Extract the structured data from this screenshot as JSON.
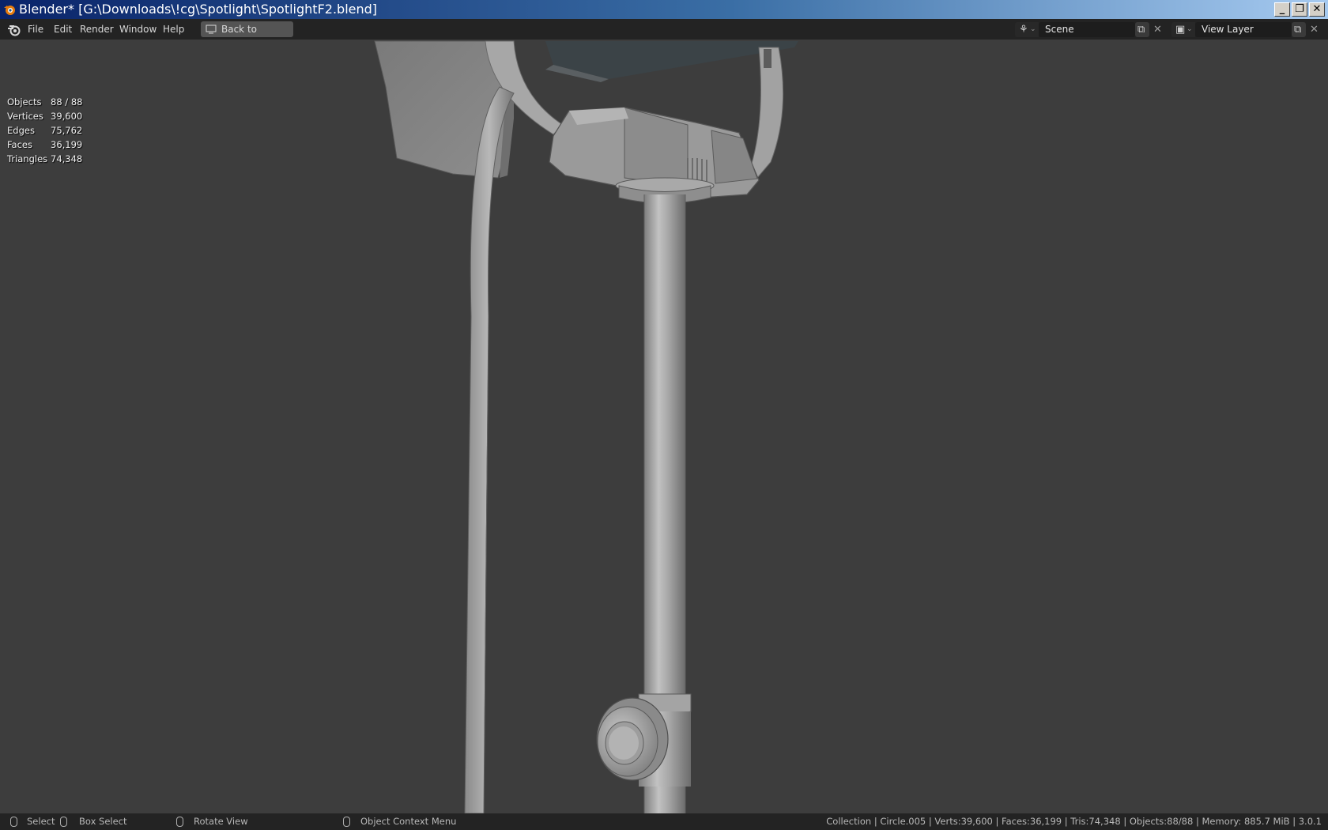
{
  "window": {
    "title": "Blender* [G:\\Downloads\\!cg\\Spotlight\\SpotlightF2.blend]",
    "minimize_glyph": "_",
    "restore_glyph": "❐",
    "close_glyph": "✕"
  },
  "menu": {
    "items": [
      "File",
      "Edit",
      "Render",
      "Window",
      "Help"
    ],
    "back_button": "Back to Previous"
  },
  "scene": {
    "label": "Scene"
  },
  "view_layer": {
    "label": "View Layer"
  },
  "stats": [
    {
      "key": "Objects",
      "value": "88 / 88"
    },
    {
      "key": "Vertices",
      "value": "39,600"
    },
    {
      "key": "Edges",
      "value": "75,762"
    },
    {
      "key": "Faces",
      "value": "36,199"
    },
    {
      "key": "Triangles",
      "value": "74,348"
    }
  ],
  "statusbar": {
    "select": "Select",
    "box_select": "Box Select",
    "rotate_view": "Rotate View",
    "context_menu": "Object Context Menu",
    "info": "Collection | Circle.005 | Verts:39,600 | Faces:36,199 | Tris:74,348 | Objects:88/88 | Memory: 885.7 MiB | 3.0.1"
  },
  "colors": {
    "viewport_bg": "#3d3d3d",
    "topbar_bg": "#232323",
    "model_gray": "#9a9a9a"
  }
}
